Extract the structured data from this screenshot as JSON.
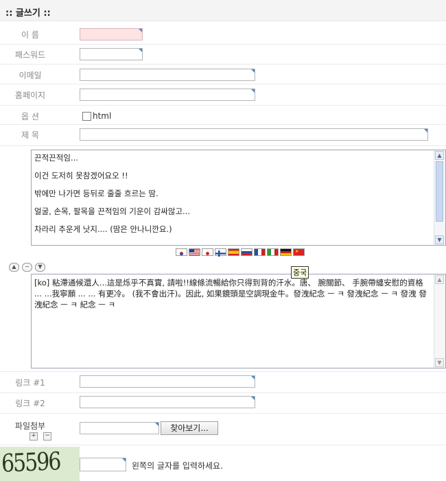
{
  "header": {
    "title": ":: 글쓰기 ::"
  },
  "fields": {
    "name_label": "이 름",
    "password_label": "패스워드",
    "email_label": "이메일",
    "homepage_label": "홈페이지",
    "option_label": "옵 션",
    "html_label": "html",
    "subject_label": "제 목",
    "link1_label": "링크 #1",
    "link2_label": "링크 #2",
    "attach_label": "파일첨부"
  },
  "content": {
    "lines": [
      "끈적끈적임...",
      "이건 도저히 못참겠어요오 !!",
      "밖에만 나가면 등뒤로 줄줄 흐르는 땀.",
      "얼굴, 손목, 팔목을 끈적임의 기운이 감싸않고...",
      "차라리 추운게 낫지.... (땀은 안나니깐요.)"
    ]
  },
  "translation": {
    "text": "[ko] 粘滯通候還人...這是烁乎不真實, 請啦!!線條流暢給你只得到背的汗水。唐、 腕關節、 手腕帶纏安慰的資格 ... ...我寧願 ... ... 有更冷。 (我不會出汗)。因此, 如果鏡頭是空調現金牛。發洩紀念 ㅡ ㅋ 發洩紀念 ㅡ ㅋ 發洩 發洩紀念 ㅡ ㅋ 紀念 ㅡ ㅋ",
    "tooltip": "중국"
  },
  "flags": [
    "korean-flag",
    "usa-flag",
    "japan-flag",
    "finland-flag",
    "spain-flag",
    "russia-flag",
    "france-flag",
    "italy-flag",
    "germany-flag",
    "china-flag"
  ],
  "attach": {
    "browse_label": "찾아보기..."
  },
  "captcha": {
    "code": "65596",
    "hint": "왼쪽의 글자를 입력하세요."
  }
}
